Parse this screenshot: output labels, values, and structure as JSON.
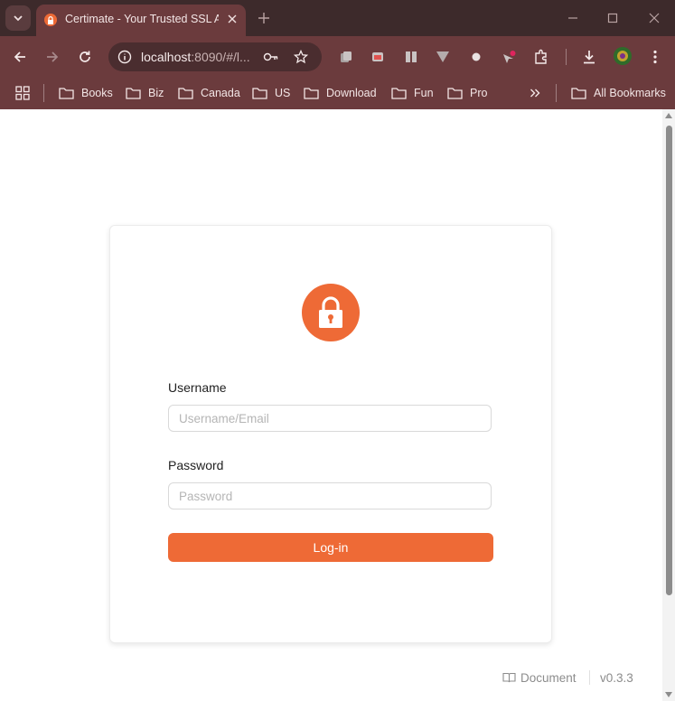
{
  "browser": {
    "tab_title": "Certimate - Your Trusted SSL Automation Partner",
    "url_host": "localhost",
    "url_rest": ":8090/#/l...",
    "colors": {
      "frame": "#6b3b3d",
      "tabstrip": "#3d2a2b",
      "omnibox": "#4a2d2f"
    },
    "icons": [
      "tab-search-icon",
      "lock-icon",
      "close-icon",
      "plus-icon",
      "minimize-icon",
      "maximize-icon",
      "close-icon",
      "back-arrow-icon",
      "forward-arrow-icon",
      "reload-icon",
      "info-icon",
      "key-icon",
      "star-icon",
      "extensions-icon",
      "download-icon",
      "profile-icon",
      "kebab-menu-icon",
      "apps-grid-icon",
      "folder-icon",
      "chevron-double-right-icon"
    ]
  },
  "bookmarks": {
    "items": [
      "Books",
      "Biz",
      "Canada",
      "US",
      "Download",
      "Fun",
      "Pro"
    ],
    "all_label": "All Bookmarks"
  },
  "login": {
    "username_label": "Username",
    "username_placeholder": "Username/Email",
    "username_value": "",
    "password_label": "Password",
    "password_placeholder": "Password",
    "password_value": "",
    "submit_label": "Log-in",
    "accent_color": "#ee6a36"
  },
  "footer": {
    "document_label": "Document",
    "version": "v0.3.3"
  }
}
